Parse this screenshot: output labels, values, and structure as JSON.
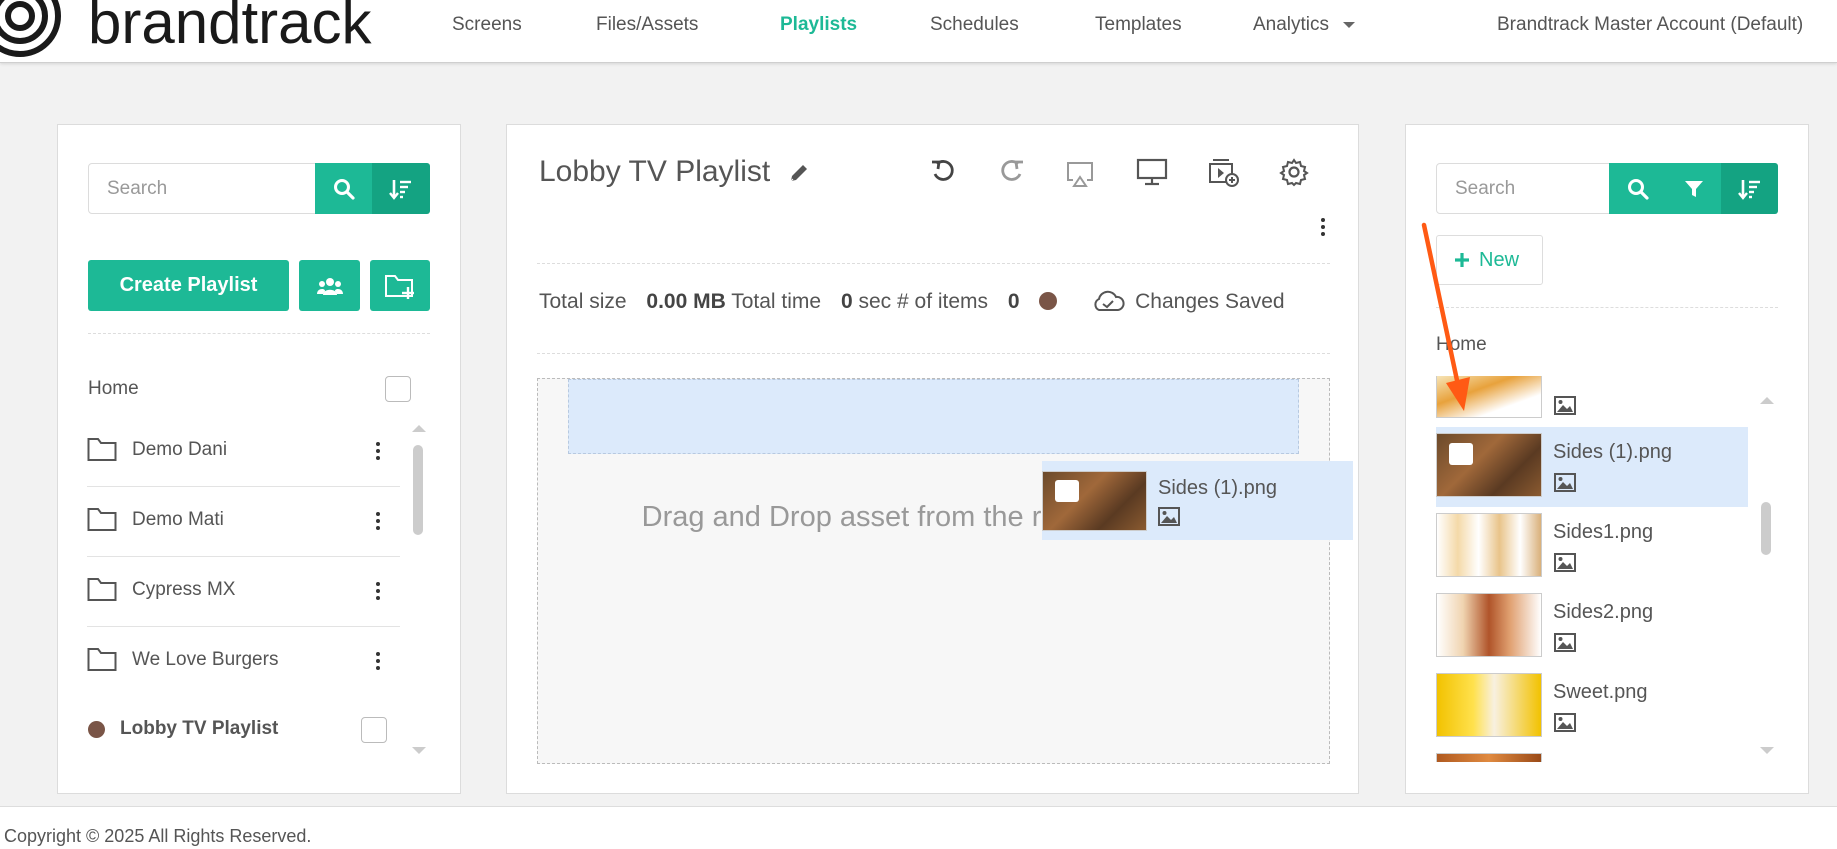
{
  "nav": {
    "brand": "brandtrack",
    "items": [
      {
        "label": "Screens"
      },
      {
        "label": "Files/Assets"
      },
      {
        "label": "Playlists"
      },
      {
        "label": "Schedules"
      },
      {
        "label": "Templates"
      },
      {
        "label": "Analytics"
      }
    ],
    "account": "Brandtrack Master Account (Default)"
  },
  "left": {
    "search_placeholder": "Search",
    "create_label": "Create Playlist",
    "home_label": "Home",
    "folders": [
      {
        "label": "Demo Dani"
      },
      {
        "label": "Demo Mati"
      },
      {
        "label": "Cypress MX"
      },
      {
        "label": "We Love Burgers"
      }
    ],
    "playlist": {
      "label": "Lobby TV Playlist",
      "dot_color": "#7a5547"
    }
  },
  "middle": {
    "title": "Lobby TV Playlist",
    "stats": {
      "size_label": "Total size",
      "size_value": "0.00 MB",
      "time_label": "Total time",
      "time_value": "0",
      "time_unit": "sec",
      "items_label": "# of items",
      "items_value": "0",
      "saved_label": "Changes Saved"
    },
    "drop_text": "Drag and Drop asset from the right or to here!",
    "dragging": {
      "name": "Sides (1).png"
    }
  },
  "right": {
    "search_placeholder": "Search",
    "new_label": "New",
    "home_label": "Home",
    "assets": [
      {
        "name": ""
      },
      {
        "name": "Sides (1).png",
        "selected": true
      },
      {
        "name": "Sides1.png"
      },
      {
        "name": "Sides2.png"
      },
      {
        "name": "Sweet.png"
      }
    ]
  },
  "footer": {
    "text": "Copyright © 2025 All Rights Reserved."
  },
  "colors": {
    "accent": "#1db996",
    "accent_dark": "#14a382",
    "highlight": "#dceafb",
    "arrow": "#ff5a14"
  }
}
